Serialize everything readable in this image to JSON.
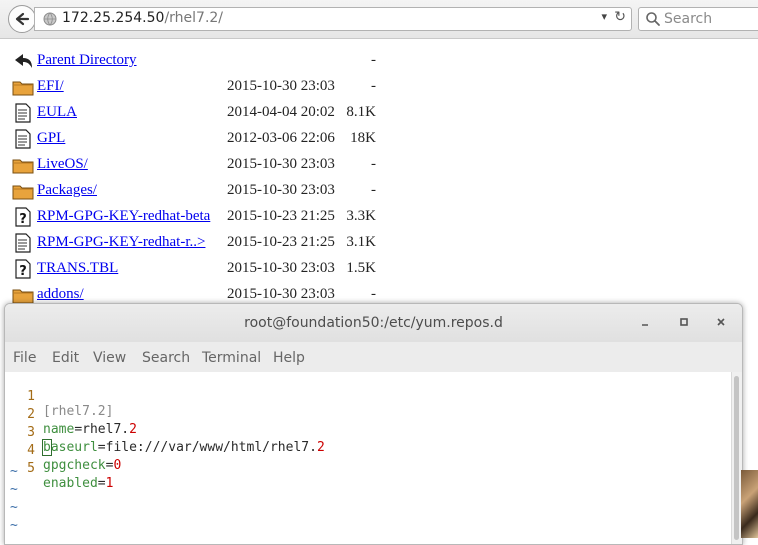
{
  "browser": {
    "url_host": "172.25.254.50",
    "url_path": "/rhel7.2/",
    "search_placeholder": "Search",
    "icons": {
      "back": "back-arrow-icon",
      "site": "globe-icon",
      "dropdown": "chevron-down-icon",
      "reload": "reload-icon",
      "search": "magnifier-icon"
    }
  },
  "listing": {
    "rows": [
      {
        "name": "Parent Directory",
        "date": "",
        "size": "-",
        "icon": "back-folder-icon"
      },
      {
        "name": "EFI/",
        "date": "2015-10-30 23:03",
        "size": "-",
        "icon": "folder-icon"
      },
      {
        "name": "EULA",
        "date": "2014-04-04 20:02",
        "size": "8.1K",
        "icon": "text-file-icon"
      },
      {
        "name": "GPL",
        "date": "2012-03-06 22:06",
        "size": "18K",
        "icon": "text-file-icon"
      },
      {
        "name": "LiveOS/",
        "date": "2015-10-30 23:03",
        "size": "-",
        "icon": "folder-icon"
      },
      {
        "name": "Packages/",
        "date": "2015-10-30 23:03",
        "size": "-",
        "icon": "folder-icon"
      },
      {
        "name": "RPM-GPG-KEY-redhat-beta",
        "date": "2015-10-23 21:25",
        "size": "3.3K",
        "icon": "unknown-file-icon"
      },
      {
        "name": "RPM-GPG-KEY-redhat-r..>",
        "date": "2015-10-23 21:25",
        "size": "3.1K",
        "icon": "text-file-icon"
      },
      {
        "name": "TRANS.TBL",
        "date": "2015-10-30 23:03",
        "size": "1.5K",
        "icon": "unknown-file-icon"
      },
      {
        "name": "addons/",
        "date": "2015-10-30 23:03",
        "size": "-",
        "icon": "folder-icon"
      }
    ]
  },
  "terminal": {
    "title": "root@foundation50:/etc/yum.repos.d",
    "menu": [
      "File",
      "Edit",
      "View",
      "Search",
      "Terminal",
      "Help"
    ],
    "lines": [
      {
        "num": "1",
        "text": "[rhel7.2]"
      },
      {
        "num": "2",
        "key": "name",
        "value": "rhel7.",
        "num_tail": "2"
      },
      {
        "num": "3",
        "key": "baseurl",
        "value": "file:///var/www/html/rhel7.",
        "num_tail": "2"
      },
      {
        "num": "4",
        "key": "gpgcheck",
        "value": "",
        "num_tail": "0"
      },
      {
        "num": "5",
        "key": "enabled",
        "value": "",
        "num_tail": "1"
      }
    ],
    "tilde": "~",
    "controls": {
      "minimize": "minimize-icon",
      "maximize": "maximize-icon",
      "close": "close-icon"
    }
  }
}
